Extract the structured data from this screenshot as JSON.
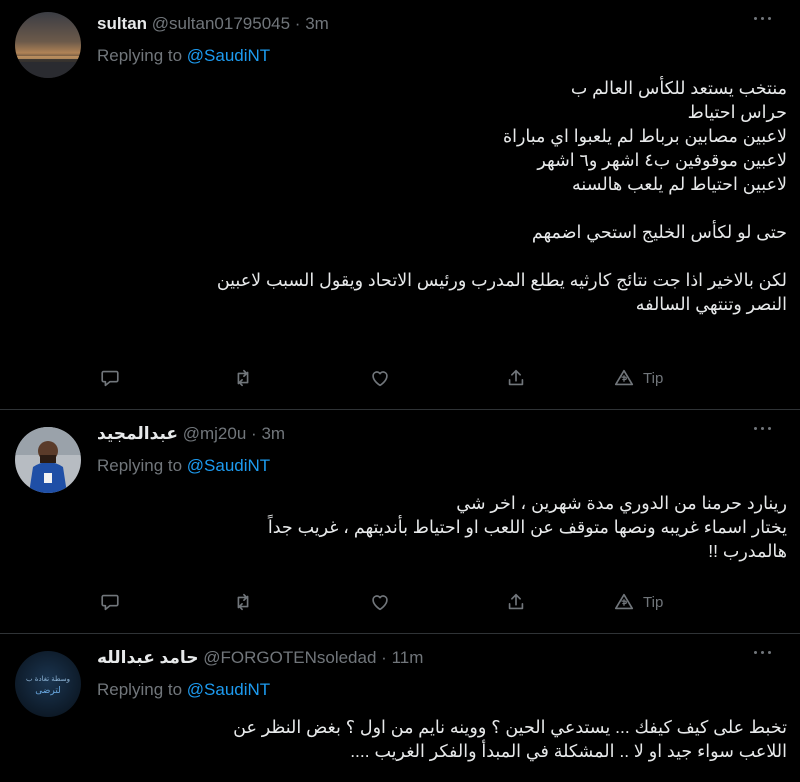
{
  "tweets": [
    {
      "name": "sultan",
      "handle": "@sultan01795045",
      "sep": "·",
      "time": "3m",
      "replying_prefix": "Replying to ",
      "mention": "@SaudiNT",
      "lines": [
        "منتخب يستعد للكأس العالم ب",
        "حراس احتياط",
        "لاعبين مصابين برباط لم يلعبوا اي مباراة",
        "لاعبين موقوفين ب٤ اشهر و٦ اشهر",
        "لاعبين احتياط لم يلعب هالسنه",
        "",
        "حتى لو لكأس الخليج استحي اضمهم",
        "",
        "لكن بالاخير اذا جت نتائج كارثيه يطلع المدرب ورئيس الاتحاد ويقول السبب لاعبين",
        "النصر وتنتهي السالفه"
      ],
      "tip_label": "Tip"
    },
    {
      "name": "عبدالمجيد",
      "handle": "@mj20u",
      "sep": "·",
      "time": "3m",
      "replying_prefix": "Replying to ",
      "mention": "@SaudiNT",
      "lines": [
        "رينارد حرمنا من الدوري مدة شهرين ، اخر شي",
        "يختار اسماء غريبه ونصها  متوقف عن اللعب او احتياط بأنديتهم ، غريب جداً",
        "هالمدرب !!"
      ],
      "tip_label": "Tip"
    },
    {
      "name": "حامد عبدالله",
      "handle": "@FORGOTENsoledad",
      "sep": "·",
      "time": "11m",
      "replying_prefix": "Replying to ",
      "mention": "@SaudiNT",
      "lines": [
        "تخبط على كيف كيفك ... يستدعي الحين ؟ ووينه نايم من اول ؟ بغض النظر عن",
        "اللاعب سواء جيد او لا .. المشكلة في المبدأ والفكر الغريب ...."
      ],
      "avatar_text": [
        "وسطة تغادة ب",
        "لترضى"
      ]
    }
  ],
  "colors": {
    "background": "#000000",
    "text": "#e7e9ea",
    "muted": "#71767b",
    "link": "#1d9bf0",
    "divider": "#2f3336"
  },
  "icons": [
    "reply-icon",
    "retweet-icon",
    "like-icon",
    "share-icon",
    "tip-icon",
    "more-icon"
  ]
}
